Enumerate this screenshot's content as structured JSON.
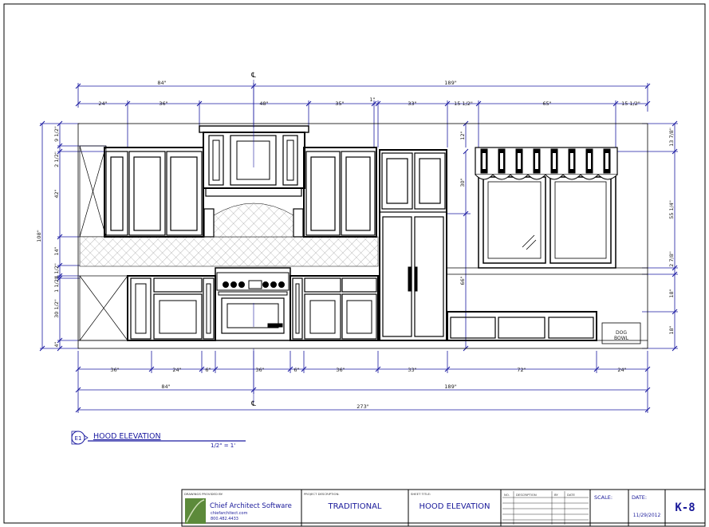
{
  "dimensions": {
    "top_row1": [
      "84\"",
      "189\""
    ],
    "top_row2": [
      "24\"",
      "36\"",
      "48\"",
      "35\"",
      "1\"",
      "33\"",
      "15 1/2\"",
      "65\"",
      "15 1/2\""
    ],
    "left": [
      "108\"",
      "42\"",
      "9 1/2\"",
      "2 1/2\"",
      "14\"",
      "4 1/2\"",
      "1 1/2\"",
      "30 1/2\"",
      "4\""
    ],
    "right": [
      "13 7/8\"",
      "55 1/4\"",
      "2 7/8\"",
      "18\"",
      "18\""
    ],
    "interior": [
      "12\"",
      "30\"",
      "66\""
    ],
    "bottom_row1": [
      "36\"",
      "24\"",
      "6\"",
      "36\"",
      "6\"",
      "36\"",
      "33\"",
      "72\"",
      "24\""
    ],
    "bottom_row2": [
      "84\"",
      "189\""
    ],
    "bottom_total": "273\"",
    "centerline": "℄"
  },
  "labels": {
    "dog_bowl_1": "DOG",
    "dog_bowl_2": "BOWL"
  },
  "elevation": {
    "tag": "E1",
    "title": "HOOD ELEVATION",
    "scale": "1/2\" = 1'"
  },
  "title_block": {
    "provided_by_label": "DRAWINGS PROVIDED BY:",
    "company": "Chief Architect Software",
    "website": "chiefarchitect.com",
    "phone": "800.482.4433",
    "project_label": "PROJECT DESCRIPTION:",
    "project": "TRADITIONAL",
    "sheet_title_label": "SHEET TITLE:",
    "sheet_title": "HOOD ELEVATION",
    "rev_cols": [
      "NO.",
      "DESCRIPTION",
      "BY",
      "DATE"
    ],
    "scale_label": "SCALE:",
    "date_label": "DATE:",
    "date": "11/29/2012",
    "sheet_no": "K-8"
  },
  "colors": {
    "dimension_line": "#1a1aa0",
    "linework": "#000000",
    "titleblock_text": "#1a1a9a"
  }
}
